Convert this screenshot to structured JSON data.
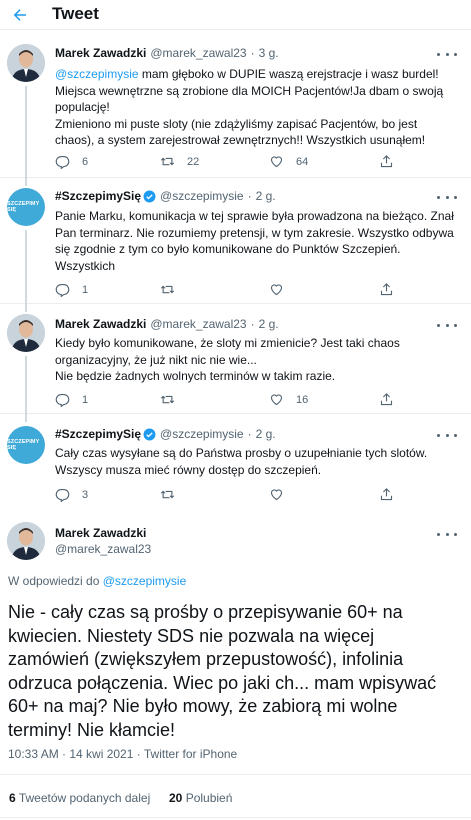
{
  "header": {
    "title": "Tweet"
  },
  "tweets": [
    {
      "name": "Marek Zawadzki",
      "handle": "@marek_zawal23",
      "time": "3 g.",
      "mention": "@szczepimysie",
      "text_after_mention": " mam głęboko w DUPIE waszą erejstracje i wasz burdel! Miejsca wewnętrzne są zrobione dla MOICH Pacjentów!Ja dbam o swoją populację!",
      "text_line2": "Zmieniono mi puste sloty (nie zdążyliśmy zapisać Pacjentów, bo jest chaos), a system zarejestrował zewnętrznych!! Wszystkich usunąłem!",
      "replies": "6",
      "retweets": "22",
      "likes": "64"
    },
    {
      "name": "#SzczepimySię",
      "handle": "@szczepimysie",
      "time": "2 g.",
      "avatar_text": "SZCZEPIMY SIĘ",
      "text": "Panie Marku, komunikacja w tej sprawie była prowadzona na bieżąco. Znał Pan terminarz. Nie rozumiemy pretensji, w tym zakresie. Wszystko odbywa się zgodnie z tym co było komunikowane do Punktów Szczepień. Wszystkich",
      "replies": "1",
      "retweets": "",
      "likes": ""
    },
    {
      "name": "Marek Zawadzki",
      "handle": "@marek_zawal23",
      "time": "2 g.",
      "text": "Kiedy było komunikowane, że sloty mi zmienicie? Jest taki chaos organizacyjny, że już nikt nic nie wie...",
      "text_line2": "Nie będzie żadnych wolnych terminów w takim razie.",
      "replies": "1",
      "retweets": "",
      "likes": "16"
    },
    {
      "name": "#SzczepimySię",
      "handle": "@szczepimysie",
      "time": "2 g.",
      "avatar_text": "SZCZEPIMY SIĘ",
      "text": "Cały czas wysyłane są do Państwa prosby o uzupełnianie tych slotów. Wszyscy musza mieć równy dostęp do szczepień.",
      "replies": "3",
      "retweets": "",
      "likes": ""
    }
  ],
  "focus": {
    "name": "Marek Zawadzki",
    "handle": "@marek_zawal23",
    "replying_prefix": "W odpowiedzi do ",
    "replying_to": "@szczepimysie",
    "text": "Nie - cały czas są prośby o przepisywanie 60+ na kwiecien. Niestety SDS nie pozwala na więcej zamówień (zwiększyłem przepustowość), infolinia odrzuca połączenia. Wiec po jaki ch... mam wpisywać 60+ na maj? Nie było mowy, że zabiorą mi wolne terminy! Nie kłamcie!",
    "timestamp": "10:33 AM · 14 kwi 2021 · Twitter for iPhone",
    "retweets_count": "6",
    "retweets_label": "Tweetów podanych dalej",
    "likes_count": "20",
    "likes_label": "Polubień"
  },
  "colors": {
    "accent": "#1d9bf0",
    "text": "#0f1419",
    "muted": "#536471",
    "border": "#ebeef0"
  }
}
